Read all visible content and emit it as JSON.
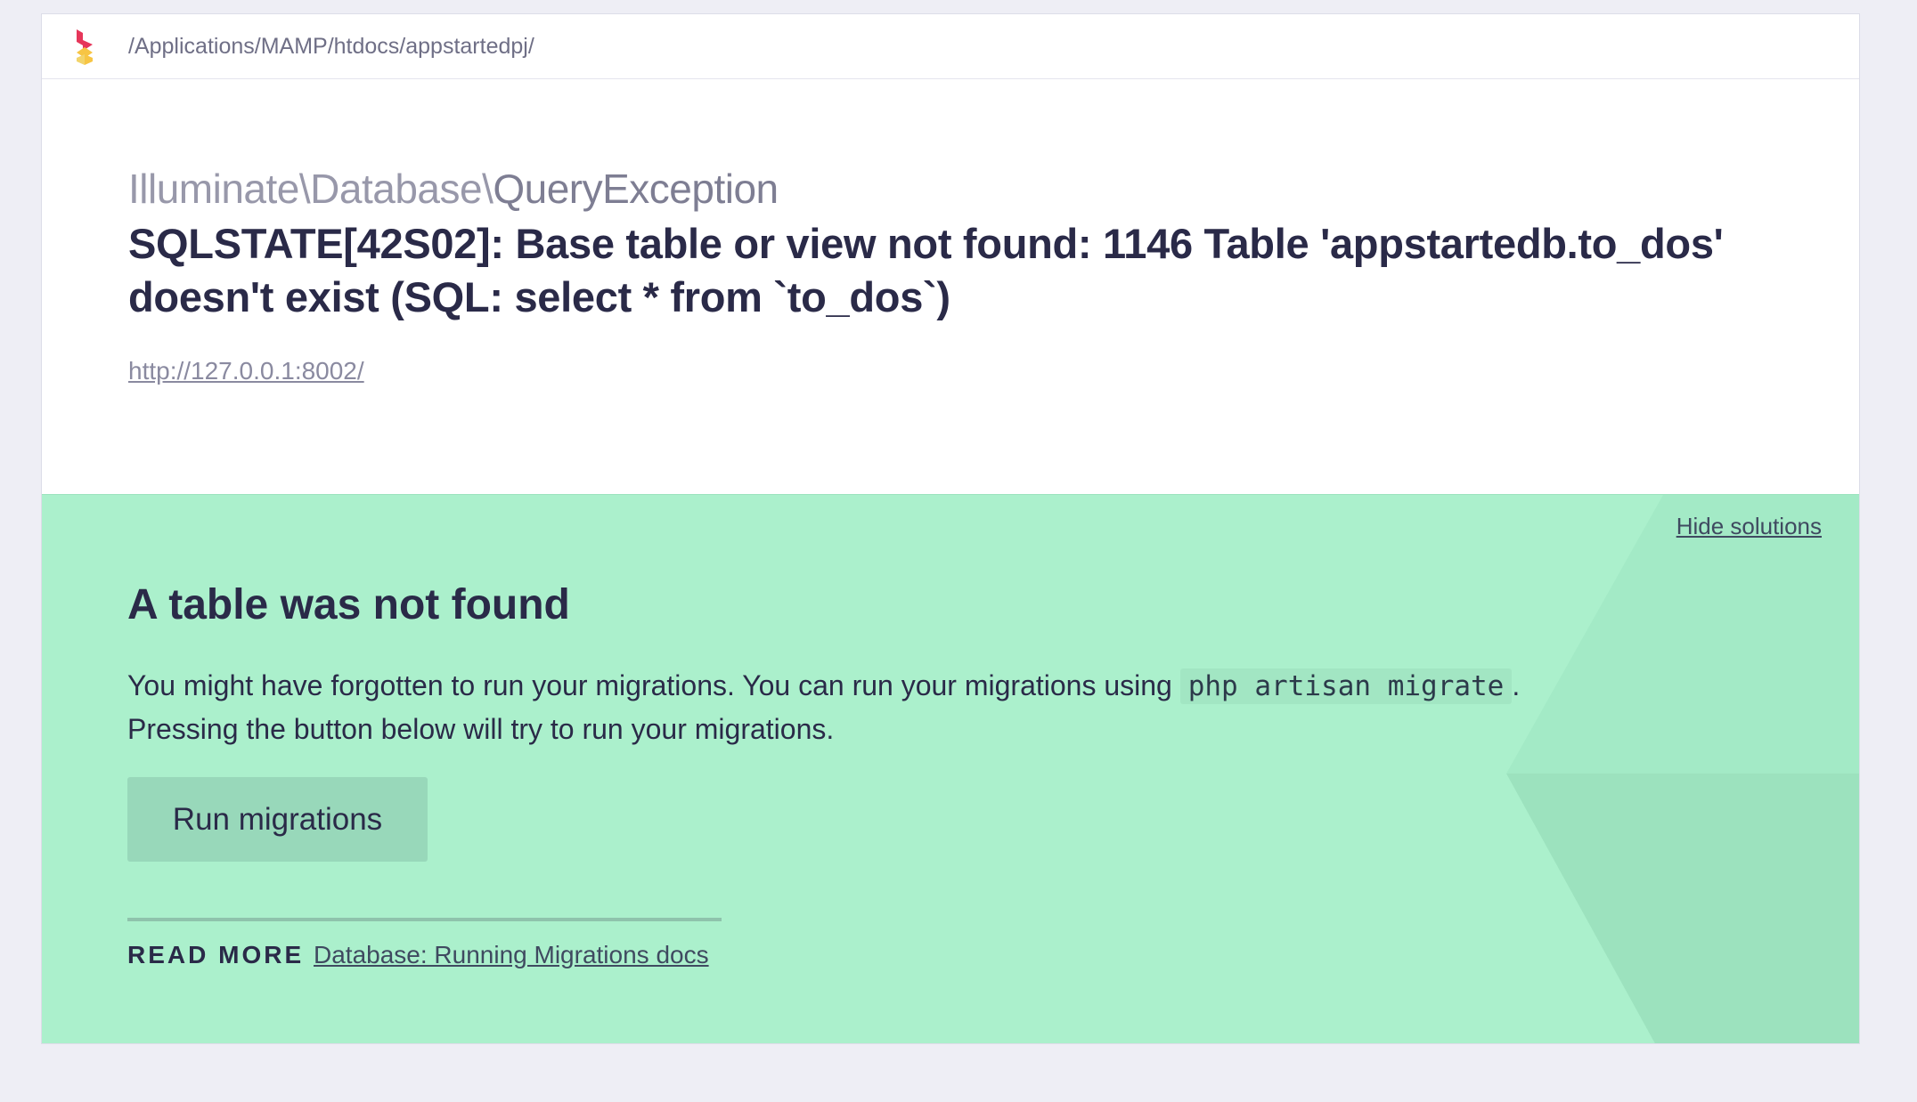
{
  "topbar": {
    "path": "/Applications/MAMP/htdocs/appstartedpj/"
  },
  "exception": {
    "namespace": "Illuminate\\Database\\",
    "class_name": "QueryException",
    "message": "SQLSTATE[42S02]: Base table or view not found: 1146 Table 'appstartedb.to_dos' doesn't exist (SQL: select * from `to_dos`)",
    "url": "http://127.0.0.1:8002/"
  },
  "solution": {
    "hide_label": "Hide solutions",
    "title": "A table was not found",
    "desc_before_code": "You might have forgotten to run your migrations. You can run your migrations using ",
    "code": "php artisan migrate",
    "desc_after_code": ".",
    "desc_line2": "Pressing the button below will try to run your migrations.",
    "button_label": "Run migrations",
    "read_more_label": "READ MORE",
    "docs_link": "Database: Running Migrations docs"
  },
  "colors": {
    "page_bg": "#eeeef5",
    "solution_bg": "#abf0cc",
    "button_bg": "#98d8ba",
    "text": "#2a2a48"
  },
  "icons": {
    "logo": "ignition-logo-icon"
  }
}
